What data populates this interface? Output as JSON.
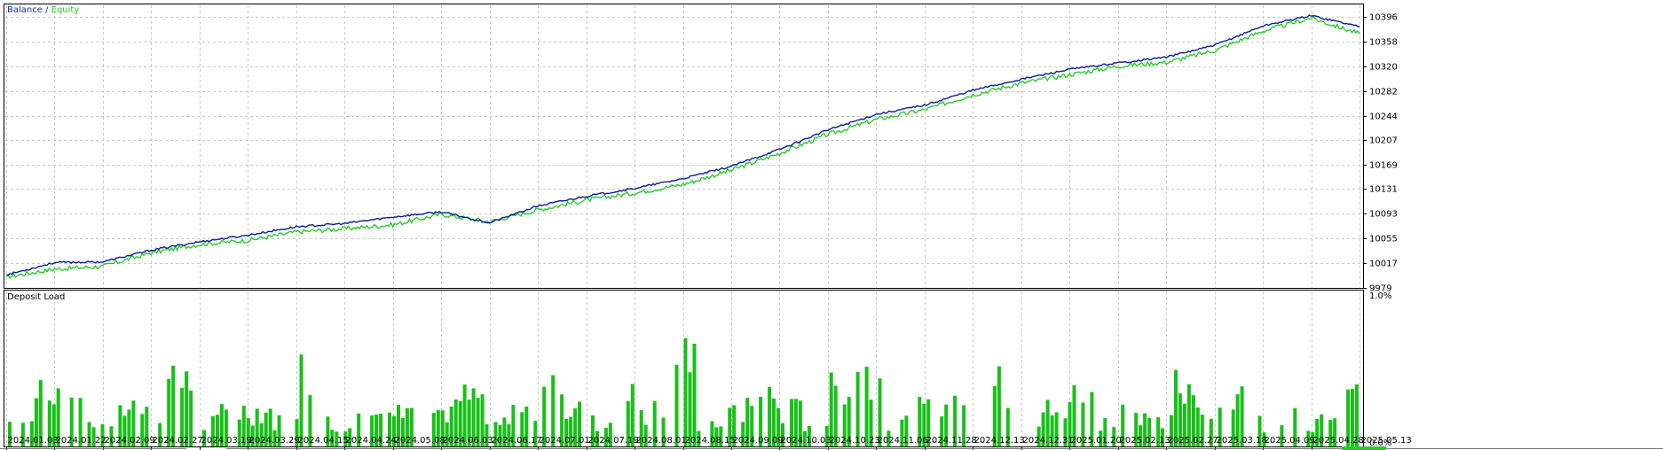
{
  "colors": {
    "balance": "#0a1f8f",
    "equity": "#1ec81e",
    "load": "#18c018",
    "grid": "#c8c8c8",
    "legend_balance": "#1a2aa8",
    "legend_equity": "#1ec81e"
  },
  "legend": {
    "balance": "Balance",
    "separator": " / ",
    "equity": "Equity"
  },
  "load_title": "Deposit Load",
  "chart_data": [
    {
      "type": "line",
      "title": "",
      "ylim": [
        9979,
        10415
      ],
      "ticks_y": [
        9979,
        10017,
        10055,
        10093,
        10131,
        10169,
        10207,
        10244,
        10282,
        10320,
        10358,
        10396
      ],
      "x": [
        "2024.01.03",
        "2024.01.22",
        "2024.02.09",
        "2024.02.27",
        "2024.03.19",
        "2024.03.29",
        "2024.04.15",
        "2024.04.24",
        "2024.05.08",
        "2024.06.03",
        "2024.06.17",
        "2024.07.01",
        "2024.07.19",
        "2024.08.01",
        "2024.08.15",
        "2024.09.09",
        "2024.10.03",
        "2024.10.23",
        "2024.11.06",
        "2024.11.28",
        "2024.12.13",
        "2024.12.31",
        "2025.01.20",
        "2025.02.13",
        "2025.02.27",
        "2025.03.18",
        "2025.04.09",
        "2025.04.28",
        "2025.05.13"
      ],
      "series": [
        {
          "name": "Balance",
          "values": [
            9999,
            10018,
            10019,
            10037,
            10050,
            10060,
            10073,
            10078,
            10088,
            10096,
            10079,
            10105,
            10120,
            10132,
            10147,
            10166,
            10192,
            10222,
            10246,
            10260,
            10283,
            10300,
            10315,
            10325,
            10334,
            10352,
            10382,
            10398,
            10381
          ]
        },
        {
          "name": "Equity",
          "values": [
            9996,
            10008,
            10012,
            10033,
            10046,
            10052,
            10065,
            10070,
            10076,
            10092,
            10081,
            10099,
            10114,
            10125,
            10138,
            10160,
            10186,
            10215,
            10238,
            10253,
            10276,
            10294,
            10307,
            10320,
            10326,
            10344,
            10374,
            10394,
            10370
          ]
        }
      ]
    },
    {
      "type": "bar",
      "title": "Deposit Load",
      "ylim": [
        0,
        1.0
      ],
      "ticks_y": [
        "1.0%",
        "0.0%"
      ],
      "series": [
        {
          "name": "Deposit Load",
          "values": [
            0.2,
            0.5,
            0.3,
            0.2,
            0.4,
            0.3,
            0.5,
            0.2,
            0.3,
            0.3,
            0.2,
            0.6,
            0.2,
            0.4,
            0.3,
            0.5,
            0.3,
            0.4,
            0.2,
            0.3,
            0.6,
            0.3,
            0.2,
            0.4,
            0.3,
            0.7,
            0.2,
            0.3,
            0.4,
            0.3,
            0.2,
            0.5,
            0.6,
            0.2,
            0.3,
            0.4,
            0.3,
            0.5,
            0.2,
            0.3,
            0.4,
            0.2,
            0.3,
            0.2,
            0.5,
            0.3,
            0.4,
            0.2,
            0.3,
            0.2,
            0.4
          ]
        }
      ]
    }
  ]
}
